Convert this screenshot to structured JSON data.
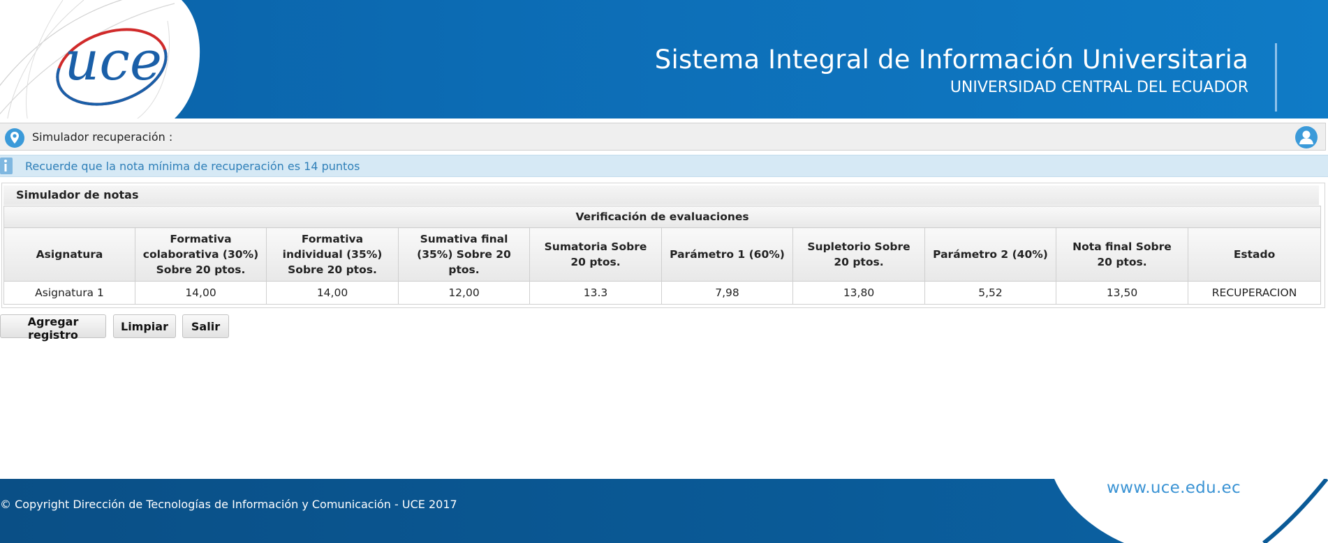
{
  "header": {
    "logo_text": "uce",
    "title": "Sistema Integral de Información Universitaria",
    "subtitle": "UNIVERSIDAD CENTRAL DEL ECUADOR"
  },
  "breadcrumb": {
    "label": "Simulador recuperación :",
    "location_icon": "location-pin-icon",
    "user_icon": "user-icon"
  },
  "info": {
    "icon": "info-icon",
    "message": "Recuerde que la nota mínima de recuperación es 14 puntos"
  },
  "panel": {
    "title": "Simulador de notas",
    "table_caption": "Verificación de evaluaciones",
    "columns": [
      "Asignatura",
      "Formativa colaborativa (30%) Sobre 20 ptos.",
      "Formativa individual (35%) Sobre 20 ptos.",
      "Sumativa final (35%) Sobre 20 ptos.",
      "Sumatoria Sobre 20 ptos.",
      "Parámetro 1 (60%)",
      "Supletorio Sobre 20 ptos.",
      "Parámetro 2 (40%)",
      "Nota final Sobre 20 ptos.",
      "Estado"
    ],
    "rows": [
      [
        "Asignatura 1",
        "14,00",
        "14,00",
        "12,00",
        "13.3",
        "7,98",
        "13,80",
        "5,52",
        "13,50",
        "RECUPERACION"
      ]
    ]
  },
  "buttons": {
    "add": "Agregar registro",
    "clear": "Limpiar",
    "exit": "Salir"
  },
  "footer": {
    "copyright": "© Copyright Dirección de Tecnologías de Información y Comunicación - UCE 2017",
    "url": "www.uce.edu.ec"
  },
  "colors": {
    "header_blue": "#0d6fb8",
    "info_bg": "#d6e9f5",
    "info_text": "#2e7fb8",
    "footer_blue": "#0a5a97",
    "logo_red": "#d02a2a"
  }
}
